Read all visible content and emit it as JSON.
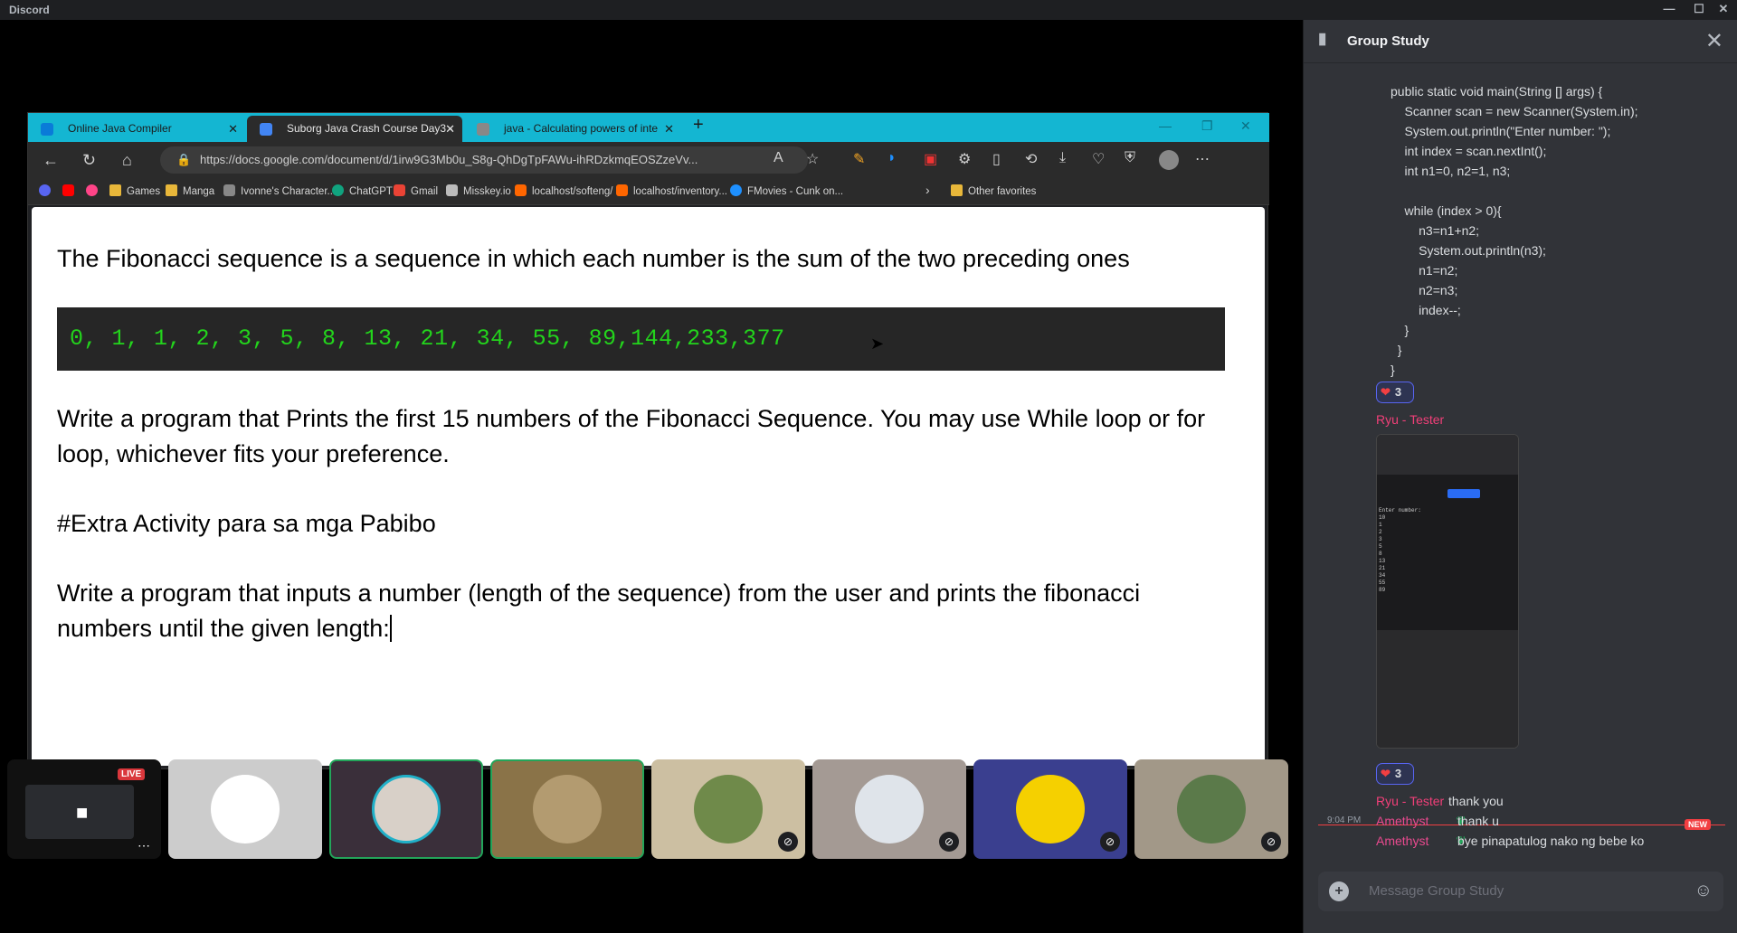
{
  "app": {
    "title": "Discord"
  },
  "browser": {
    "tabs": [
      {
        "label": "Online Java Compiler"
      },
      {
        "label": "Suborg Java Crash Course Day3 -"
      },
      {
        "label": "java - Calculating powers of inte"
      }
    ],
    "url": "https://docs.google.com/document/d/1irw9G3Mb0u_S8g-QhDgTpFAWu-ihRDzkmqEOSZzeVv...",
    "bookmarks": [
      "Games",
      "Manga",
      "Ivonne's Character...",
      "ChatGPT",
      "Gmail",
      "Misskey.io",
      "localhost/softeng/",
      "localhost/inventory...",
      "FMovies - Cunk on...",
      "Other favorites"
    ]
  },
  "document": {
    "p1": "The Fibonacci sequence is a sequence in which each number is the sum of the two preceding ones",
    "sequence": "0, 1, 1, 2, 3, 5, 8, 13, 21, 34, 55, 89,144,233,377",
    "p2": "Write a program that Prints the first 15 numbers of the Fibonacci Sequence. You may use While loop or for loop, whichever fits your preference.",
    "p3": "#Extra Activity para sa mga Pabibo",
    "p4": "Write a program that inputs a number (length of the sequence) from the user and prints the fibonacci numbers until the given length:"
  },
  "stream": {
    "live_badge": "LIVE"
  },
  "chat": {
    "title": "Group Study",
    "code": "public static void main(String [] args) {\n    Scanner scan = new Scanner(System.in);\n    System.out.println(\"Enter number: \");\n    int index = scan.nextInt();\n    int n1=0, n2=1, n3;\n\n    while (index > 0){\n        n3=n1+n2;\n        System.out.println(n3);\n        n1=n2;\n        n2=n3;\n        index--;\n    }\n  }\n}",
    "reaction1": "3",
    "reaction2": "3",
    "user1": "Ryu - Tester",
    "user1b": "Ryu - Tester",
    "msg1": "thank you",
    "time2": "9:04 PM",
    "user2": "Amethyst",
    "msg2": "thank u",
    "user2b": "Amethyst",
    "msg3": "bye pinapatulog nako ng bebe ko",
    "new_badge": "NEW",
    "placeholder": "Message Group Study",
    "phone_output": "Enter number:\n10\n1\n2\n3\n5\n8\n13\n21\n34\n55\n89"
  }
}
